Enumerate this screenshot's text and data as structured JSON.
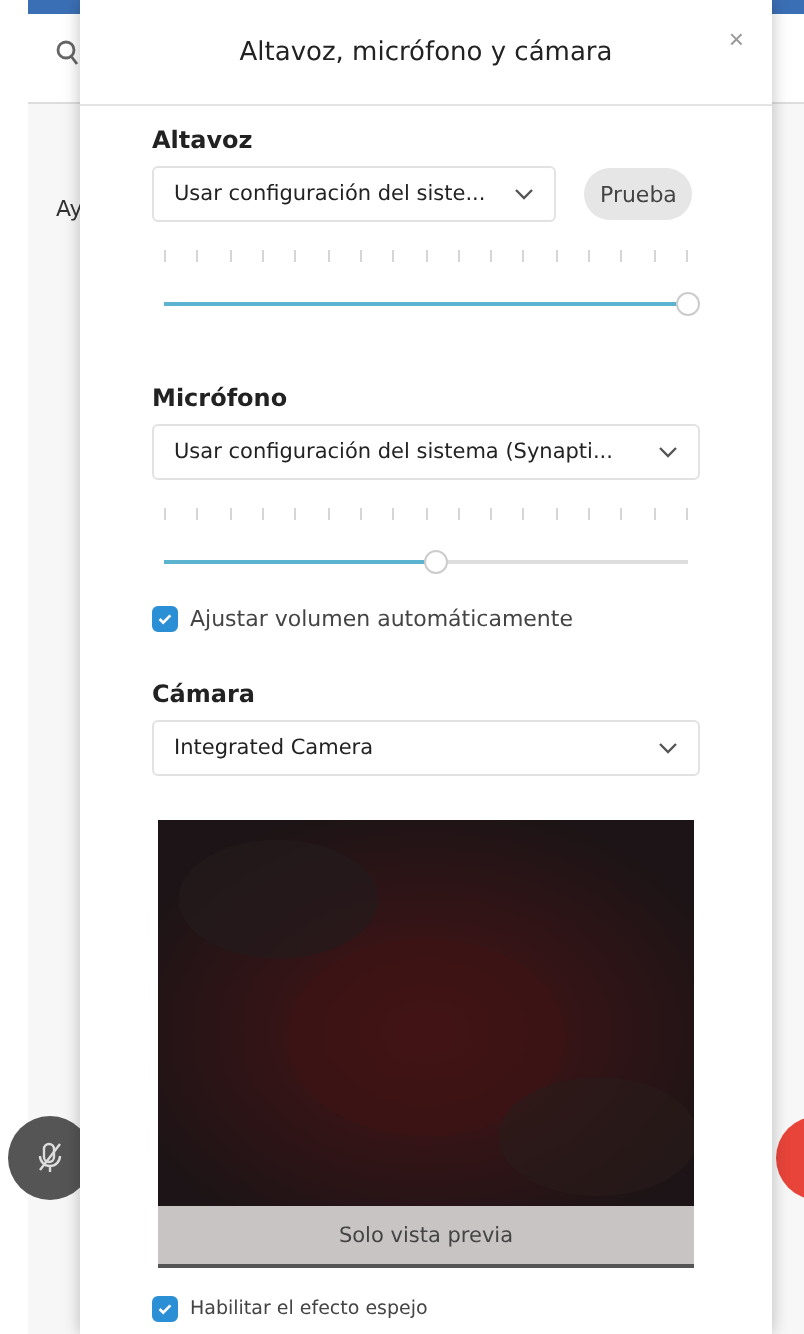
{
  "background": {
    "side_text": "Ay"
  },
  "dialog": {
    "title": "Altavoz, micrófono y cámara",
    "close": "×",
    "speaker": {
      "label": "Altavoz",
      "select": "Usar configuración del siste...",
      "test_button": "Prueba",
      "level": 1
    },
    "microphone": {
      "label": "Micrófono",
      "select": "Usar configuración del sistema (Synapti...",
      "level": 0.52,
      "auto_volume": {
        "label": "Ajustar volumen automáticamente",
        "checked": true
      }
    },
    "camera": {
      "label": "Cámara",
      "select": "Integrated Camera",
      "preview_caption": "Solo vista previa",
      "mirror": {
        "label": "Habilitar el efecto espejo",
        "checked": true
      }
    }
  }
}
